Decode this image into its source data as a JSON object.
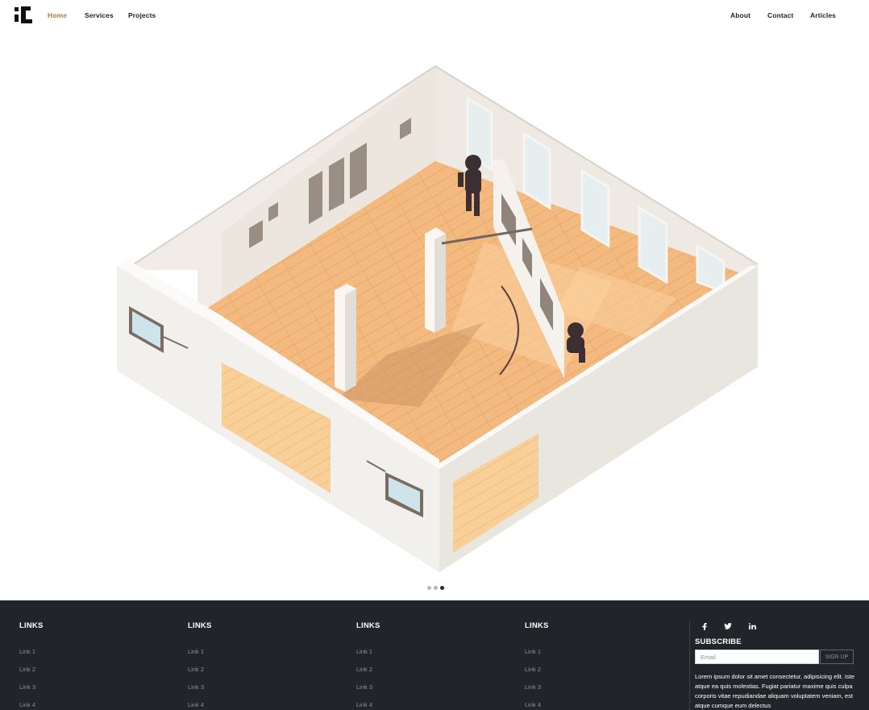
{
  "nav": {
    "left_links": [
      {
        "label": "Home",
        "active": true
      },
      {
        "label": "Services",
        "active": false
      },
      {
        "label": "Projects",
        "active": false
      }
    ],
    "right_links": [
      {
        "label": "About"
      },
      {
        "label": "Contact"
      },
      {
        "label": "Articles"
      }
    ]
  },
  "carousel": {
    "slides": 3,
    "active_index": 2
  },
  "footer": {
    "columns": [
      {
        "title": "LINKS",
        "links": [
          "Link 1",
          "Link 2",
          "Link 3",
          "Link 4"
        ]
      },
      {
        "title": "LINKS",
        "links": [
          "Link 1",
          "Link 2",
          "Link 3",
          "Link 4"
        ]
      },
      {
        "title": "LINKS",
        "links": [
          "Link 1",
          "Link 2",
          "Link 3",
          "Link 4"
        ]
      },
      {
        "title": "LINKS",
        "links": [
          "Link 1",
          "Link 2",
          "Link 3",
          "Link 4"
        ]
      }
    ],
    "social": [
      "facebook-icon",
      "twitter-icon",
      "linkedin-icon"
    ],
    "subscribe": {
      "title": "SUBSCRIBE",
      "email_placeholder": "Email",
      "button_label": "SIGN UP",
      "text": "Lorem ipsum dolor sit amet consectetur, adipisicing elit. Iste atque ea quis molestias. Fugiat pariatur maxime quis culpa corporis vitae repudiandae aliquam voluptatem veniam, est atque cumque eum delectus"
    }
  },
  "colors": {
    "accent": "#b9783a",
    "footer_bg": "#212529",
    "floor": "#f2b77a",
    "wall": "#f1eeea"
  }
}
